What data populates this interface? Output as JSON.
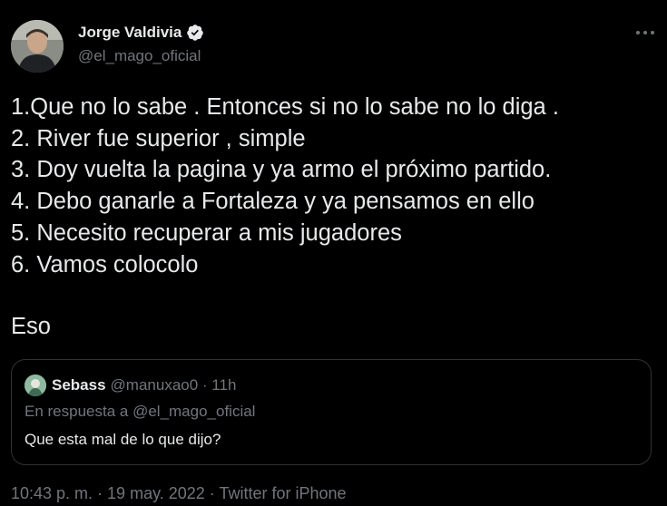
{
  "author": {
    "name": "Jorge Valdivia",
    "handle": "@el_mago_oficial",
    "verified": true
  },
  "tweet": {
    "lines": [
      "1.Que no lo sabe . Entonces si no lo sabe no lo diga .",
      "2. River fue superior , simple",
      "3. Doy vuelta la pagina y ya armo el próximo partido.",
      "4. Debo ganarle a Fortaleza y ya pensamos en ello",
      "5. Necesito recuperar a mis jugadores",
      "6. Vamos colocolo"
    ],
    "closing": "Eso"
  },
  "quoted": {
    "name": "Sebass",
    "meta": "@manuxao0 · 11h",
    "reply_to": "En respuesta a @el_mago_oficial",
    "text": "Que esta mal de lo que dijo?"
  },
  "timestamp": "10:43 p. m. · 19 may. 2022 · Twitter for iPhone",
  "icons": {
    "verified": "verified-badge-icon",
    "more": "more-options-icon"
  },
  "colors": {
    "background": "#000000",
    "text": "#e7e9ea",
    "secondary": "#71767b",
    "border": "#2f3336"
  }
}
